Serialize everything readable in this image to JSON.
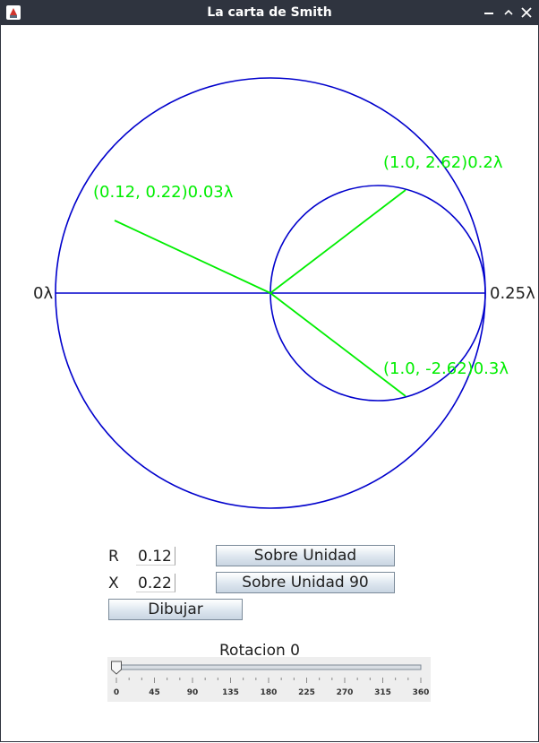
{
  "window": {
    "title": "La carta de Smith",
    "icon": "java-app-icon"
  },
  "chart": {
    "boundary_labels": {
      "left": "0λ",
      "right": "0.25λ"
    },
    "colors": {
      "chart_lines": "#0000cc",
      "points": "#00ee00",
      "background": "#ffffff"
    },
    "normalized_point": {
      "r": 0.12,
      "x": 0.22
    },
    "points": [
      {
        "label": "(0.12, 0.22)0.03λ"
      },
      {
        "label": "(1.0, 2.62)0.2λ"
      },
      {
        "label": "(1.0, -2.62)0.3λ"
      }
    ]
  },
  "controls": {
    "r_label": "R",
    "r_value": "0.12",
    "x_label": "X",
    "x_value": "0.22",
    "btn_sobre_unidad": "Sobre Unidad",
    "btn_sobre_unidad_90": "Sobre Unidad 90",
    "btn_dibujar": "Dibujar"
  },
  "slider": {
    "title": "Rotacion 0",
    "value": 0,
    "min": 0,
    "max": 360,
    "tick_labels": [
      "0",
      "45",
      "90",
      "135",
      "180",
      "225",
      "270",
      "315",
      "360"
    ]
  }
}
